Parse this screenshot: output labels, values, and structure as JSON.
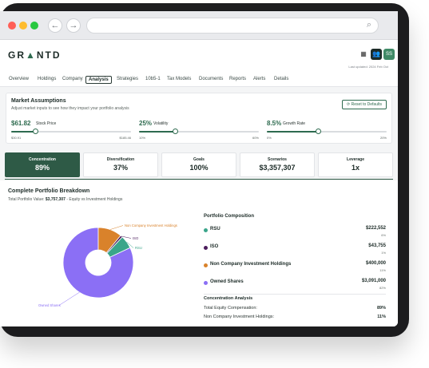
{
  "app": {
    "logo": "GR",
    "logo_arrow": "▲",
    "logo_tail": "NTD",
    "user_initials": "SS",
    "header_sub": "Last updated: 2024 Feb Oct"
  },
  "tabs": [
    {
      "label": "Overview"
    },
    {
      "label": "Holdings"
    },
    {
      "label": "Company"
    },
    {
      "label": "Analysis"
    },
    {
      "label": "Strategies"
    },
    {
      "label": "10b5-1"
    },
    {
      "label": "Tax Models"
    },
    {
      "label": "Documents"
    },
    {
      "label": "Reports"
    },
    {
      "label": "Alerts"
    },
    {
      "label": "Details"
    }
  ],
  "market": {
    "title": "Market Assumptions",
    "subtitle": "Adjust market inputs to see how they impact your portfolio analysis",
    "reset_label": "Reset to Defaults",
    "sliders": [
      {
        "value": "$61.82",
        "label": "Stock Price",
        "min": "$30.91",
        "max": "$185.46",
        "fraction": 0.2
      },
      {
        "value": "25%",
        "label": "Volatility",
        "min": "10%",
        "max": "60%",
        "fraction": 0.3
      },
      {
        "value": "8.5%",
        "label": "Growth Rate",
        "min": "0%",
        "max": "20%",
        "fraction": 0.425
      }
    ]
  },
  "cards": [
    {
      "label": "Concentration",
      "value": "89%"
    },
    {
      "label": "Diversification",
      "value": "37%"
    },
    {
      "label": "Goals",
      "value": "100%"
    },
    {
      "label": "Scenarios",
      "value": "$3,357,307"
    },
    {
      "label": "Leverage",
      "value": "1x"
    }
  ],
  "breakdown": {
    "title": "Complete Portfolio Breakdown",
    "sub_prefix": "Total Portfolio Value:",
    "sub_value": "$3,757,307",
    "sub_suffix": "- Equity vs Investment Holdings"
  },
  "chart_data": {
    "type": "pie",
    "slices": [
      {
        "name": "Owned Shares",
        "percent": 82,
        "color": "#8b6ff5"
      },
      {
        "name": "Non Company Investment Holdings",
        "percent": 11,
        "color": "#d9822b"
      },
      {
        "name": "ISO",
        "percent": 1,
        "color": "#4b1d5c"
      },
      {
        "name": "RSU",
        "percent": 6,
        "color": "#3aa58a"
      }
    ]
  },
  "composition": {
    "title": "Portfolio Composition",
    "items": [
      {
        "name": "RSU",
        "amount": "$222,552",
        "percent": "6%",
        "color": "#3aa58a"
      },
      {
        "name": "ISO",
        "amount": "$43,755",
        "percent": "1%",
        "color": "#4b1d5c"
      },
      {
        "name": "Non Company Investment Holdings",
        "amount": "$400,000",
        "percent": "11%",
        "color": "#d9822b"
      },
      {
        "name": "Owned Shares",
        "amount": "$3,091,000",
        "percent": "82%",
        "color": "#8b6ff5"
      }
    ]
  },
  "concentration": {
    "title": "Concentration Analysis",
    "rows": [
      {
        "label": "Total Equity Compensation:",
        "value": "89%"
      },
      {
        "label": "Non Company Investment Holdings:",
        "value": "11%"
      }
    ]
  },
  "colors": {
    "brand": "#2e5a46",
    "accent": "#2e6b4f"
  }
}
